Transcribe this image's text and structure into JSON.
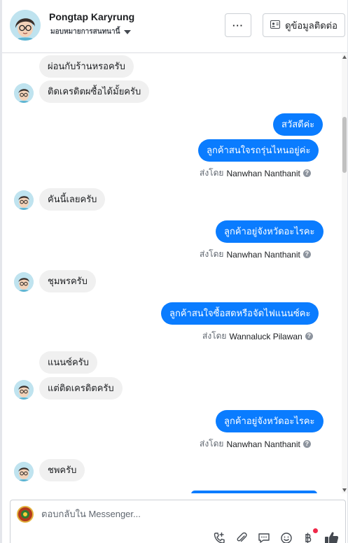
{
  "header": {
    "name": "Pongtap Karyrung",
    "assign_label": "มอบหมายการสนทนานี้",
    "more_label": "···",
    "contact_label": "ดูข้อมูลติดต่อ"
  },
  "messages": [
    {
      "text": "ผ่อนกับร้านหรอครับ"
    },
    {
      "text": "ติดเครดิตผซื้อได้มั้ยครับ"
    },
    {
      "text": "สวัสดีค่ะ"
    },
    {
      "text": "ลูกค้าสนใจรถรุ่นไหนอยู่ค่ะ"
    },
    {
      "sentby": "ส่งโดย",
      "agent": "Nanwhan Nanthanit"
    },
    {
      "text": "คันนี้เลยครับ"
    },
    {
      "text": "ลูกค้าอยู่จังหวัดอะไรคะ"
    },
    {
      "sentby": "ส่งโดย",
      "agent": "Nanwhan Nanthanit"
    },
    {
      "text": "ชุมพรครับ"
    },
    {
      "text": "ลูกค้าสนใจซื้อสดหรือจัดไฟแนนซ์คะ"
    },
    {
      "sentby": "ส่งโดย",
      "agent": "Wannaluck Pilawan"
    },
    {
      "text": "แนนซ์ครับ"
    },
    {
      "text": "แต่ติดเครดิตครับ"
    },
    {
      "text": "ลูกค้าอยู่จังหวัดอะไรคะ"
    },
    {
      "sentby": "ส่งโดย",
      "agent": "Nanwhan Nanthanit"
    },
    {
      "text": "ชพครับ"
    }
  ],
  "help_icon_glyph": "?",
  "composer": {
    "placeholder": "ตอบกลับใน Messenger..."
  },
  "icons": {
    "call": "phone-plus-icon",
    "attach": "paperclip-icon",
    "saved_replies": "chat-bubble-icon",
    "emoji": "emoji-icon",
    "payment": "baht-icon",
    "like": "thumbs-up-icon"
  },
  "colors": {
    "outgoing_bubble": "#0a7cff",
    "incoming_bubble": "#f0f0f0",
    "notification": "#f02849"
  }
}
